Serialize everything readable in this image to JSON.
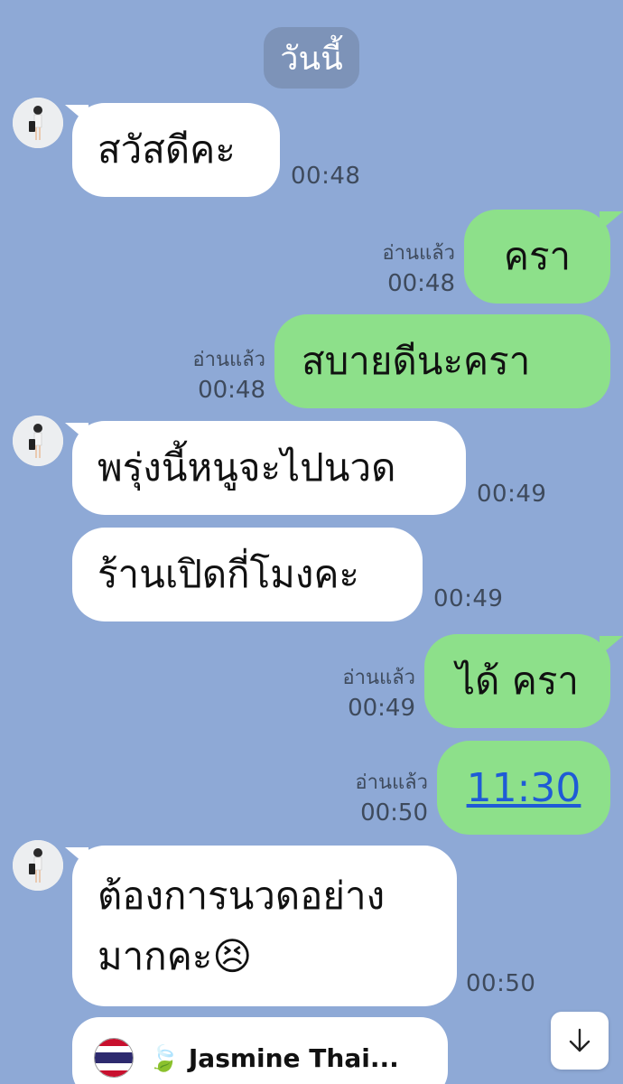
{
  "date_divider": "วันนี้",
  "messages": [
    {
      "text": "สวัสดีคะ",
      "time": "00:48"
    },
    {
      "text": "ครา",
      "read": "อ่านแล้ว",
      "time": "00:48"
    },
    {
      "text": "สบายดีนะครา",
      "read": "อ่านแล้ว",
      "time": "00:48"
    },
    {
      "text": "พรุ่งนี้หนูจะไปนวด",
      "time": "00:49"
    },
    {
      "text": "ร้านเปิดกี่โมงคะ",
      "time": "00:49"
    },
    {
      "text": "ได้ ครา",
      "read": "อ่านแล้ว",
      "time": "00:49"
    },
    {
      "text": "11:30",
      "read": "อ่านแล้ว",
      "time": "00:50"
    },
    {
      "line1": "ต้องการนวดอย่าง",
      "line2": "มากคะ😣",
      "time": "00:50"
    }
  ],
  "shared_card": {
    "title": "Jasmine Thai...",
    "leaf": "🍃"
  },
  "scroll_button": {
    "icon": "arrow-down-icon",
    "glyph": "↓"
  },
  "colors": {
    "background": "#8ea9d6",
    "outgoing": "#8de08a",
    "incoming": "#ffffff",
    "link": "#1f5bd6"
  }
}
